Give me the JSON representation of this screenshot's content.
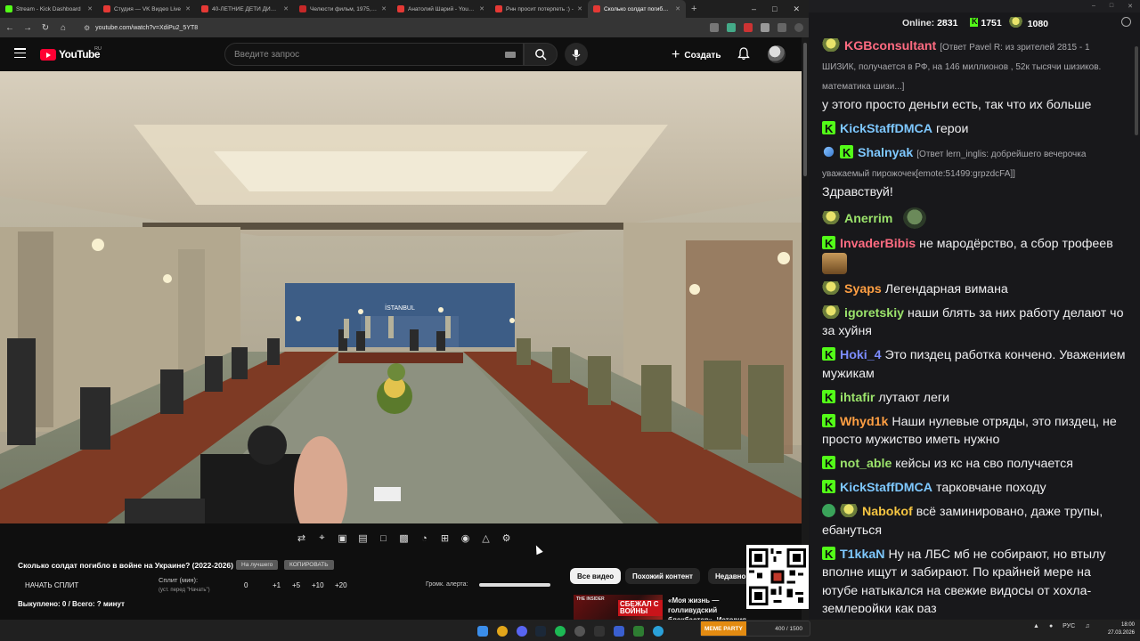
{
  "browser": {
    "tabs": [
      {
        "title": "Stream - Kick Dashboard",
        "color": "#53fc18",
        "active": false
      },
      {
        "title": "Студия — VK Видео Live",
        "color": "#e53935",
        "active": false
      },
      {
        "title": "40-ЛЕТНИЕ ДЕТИ ДИСНЕЯ",
        "color": "#e53935",
        "active": false
      },
      {
        "title": "Челюсти фильм, 1975, дата",
        "color": "#c62828",
        "active": false
      },
      {
        "title": "Анатолий Шарий - YouTube",
        "color": "#e53935",
        "active": false
      },
      {
        "title": "Рнн просит потерпеть :) -",
        "color": "#e53935",
        "active": false
      },
      {
        "title": "Сколько солдат погибло в",
        "color": "#e53935",
        "active": true
      }
    ],
    "new_tab": "+",
    "url": "youtube.com/watch?v=XdiPu2_5YT8"
  },
  "youtube": {
    "logo_text": "YouTube",
    "region": "RU",
    "search_placeholder": "Введите запрос",
    "create_label": "Создать",
    "filter_chips": [
      "Все видео",
      "Похожий контент",
      "Недавно"
    ],
    "recommendation": {
      "thumb_small": "THE INSIDER",
      "thumb_big": "СБЕЖАЛ С ВОЙНЫ",
      "title": "«Моя жизнь — голливудский блокбастер». История казак..."
    }
  },
  "extension_panel": {
    "question": "Сколько солдат погибло в войне на Украине? (2022-2026)",
    "btn_all": "На лучшего",
    "btn_copy": "КОПИРОВАТЬ",
    "start_split": "НАЧАТЬ СПЛИТ",
    "split_label": "Сплит (мин):",
    "split_hint": "(уст. перед \"Начать\")",
    "split_value": "0",
    "steps": [
      "+1",
      "+5",
      "+10",
      "+20"
    ],
    "alert_volume_label": "Громк. алерта:",
    "alert_volume": 1.0,
    "paid_line": "Выкуплено: 0 / Всего: ? минут"
  },
  "video_scene": {
    "banner_text": "İSTANBUL"
  },
  "chat": {
    "online_label": "Online:",
    "online_count": "2831",
    "kick_count": "1751",
    "gold_count": "1080",
    "messages": [
      {
        "badges": [
          "gold"
        ],
        "nick": "KGBconsultant",
        "color": "#ff6b81",
        "reply": "[Ответ Pavel R: из зрителей 2815 - 1 ШИЗИК, получается в РФ, на 146 миллионов , 52к тысячи шизиков. математика шизи...]",
        "text": "у этого просто деньги есть, так что их больше"
      },
      {
        "badges": [
          "kick"
        ],
        "nick": "KickStaffDMCA",
        "color": "#7ec8ff",
        "reply": "",
        "text": "герои"
      },
      {
        "badges": [
          "tool",
          "kick"
        ],
        "nick": "Shalnyak",
        "color": "#7ec8ff",
        "reply": "[Ответ lern_inglis: добрейшего вечерочка уважаемый пирожочек[emote:51499:grpzdcFA]]",
        "text": "Здравствуй!"
      },
      {
        "badges": [
          "gold"
        ],
        "nick": "Anerrim",
        "color": "#9be36b",
        "reply": "",
        "text": "",
        "emote": "pepe"
      },
      {
        "badges": [
          "kick"
        ],
        "nick": "InvaderBibis",
        "color": "#ff6b81",
        "reply": "",
        "text": "не мародёрство, а сбор трофеев",
        "emote": "cat"
      },
      {
        "badges": [
          "gold"
        ],
        "nick": "Syaps",
        "color": "#ff9f43",
        "reply": "",
        "text": "Легендарная вимана"
      },
      {
        "badges": [
          "gold"
        ],
        "nick": "igoretskiy",
        "color": "#9be36b",
        "reply": "",
        "text": "наши блять за них работу делают чо за хуйня"
      },
      {
        "badges": [
          "kick"
        ],
        "nick": "Hoki_4",
        "color": "#7c8cff",
        "reply": "",
        "text": "Это пиздец работка кончено. Уважением мужикам"
      },
      {
        "badges": [
          "kick"
        ],
        "nick": "ihtafir",
        "color": "#9be36b",
        "reply": "",
        "text": "лутают леги"
      },
      {
        "badges": [
          "kick"
        ],
        "nick": "Whyd1k",
        "color": "#ff9f43",
        "reply": "",
        "text": "Наши нулевые отряды, это пиздец, не просто мужиство иметь нужно"
      },
      {
        "badges": [
          "kick"
        ],
        "nick": "not_able",
        "color": "#9be36b",
        "reply": "",
        "text": "кейсы из кс на сво получается"
      },
      {
        "badges": [
          "kick"
        ],
        "nick": "KickStaffDMCA",
        "color": "#7ec8ff",
        "reply": "",
        "text": "тарковчане походу"
      },
      {
        "badges": [
          "shield",
          "gold"
        ],
        "nick": "Nabokof",
        "color": "#f5c542",
        "reply": "",
        "text": "всё заминировано, даже трупы, ебануться"
      },
      {
        "badges": [
          "kick"
        ],
        "nick": "T1kkaN",
        "color": "#7ec8ff",
        "reply": "",
        "text": "Ну на ЛБС мб не собирают, но втылу вполне ищут и забирают. По крайней мере на ютубе натыкался на свежие видосы от хохла-землеройки как раз"
      }
    ]
  },
  "taskbar": {
    "kick_label": "MEME PARTY",
    "kick_counter": "400 / 1500",
    "lang": "РУС",
    "time": "18:00",
    "date": "27.03.2026"
  }
}
